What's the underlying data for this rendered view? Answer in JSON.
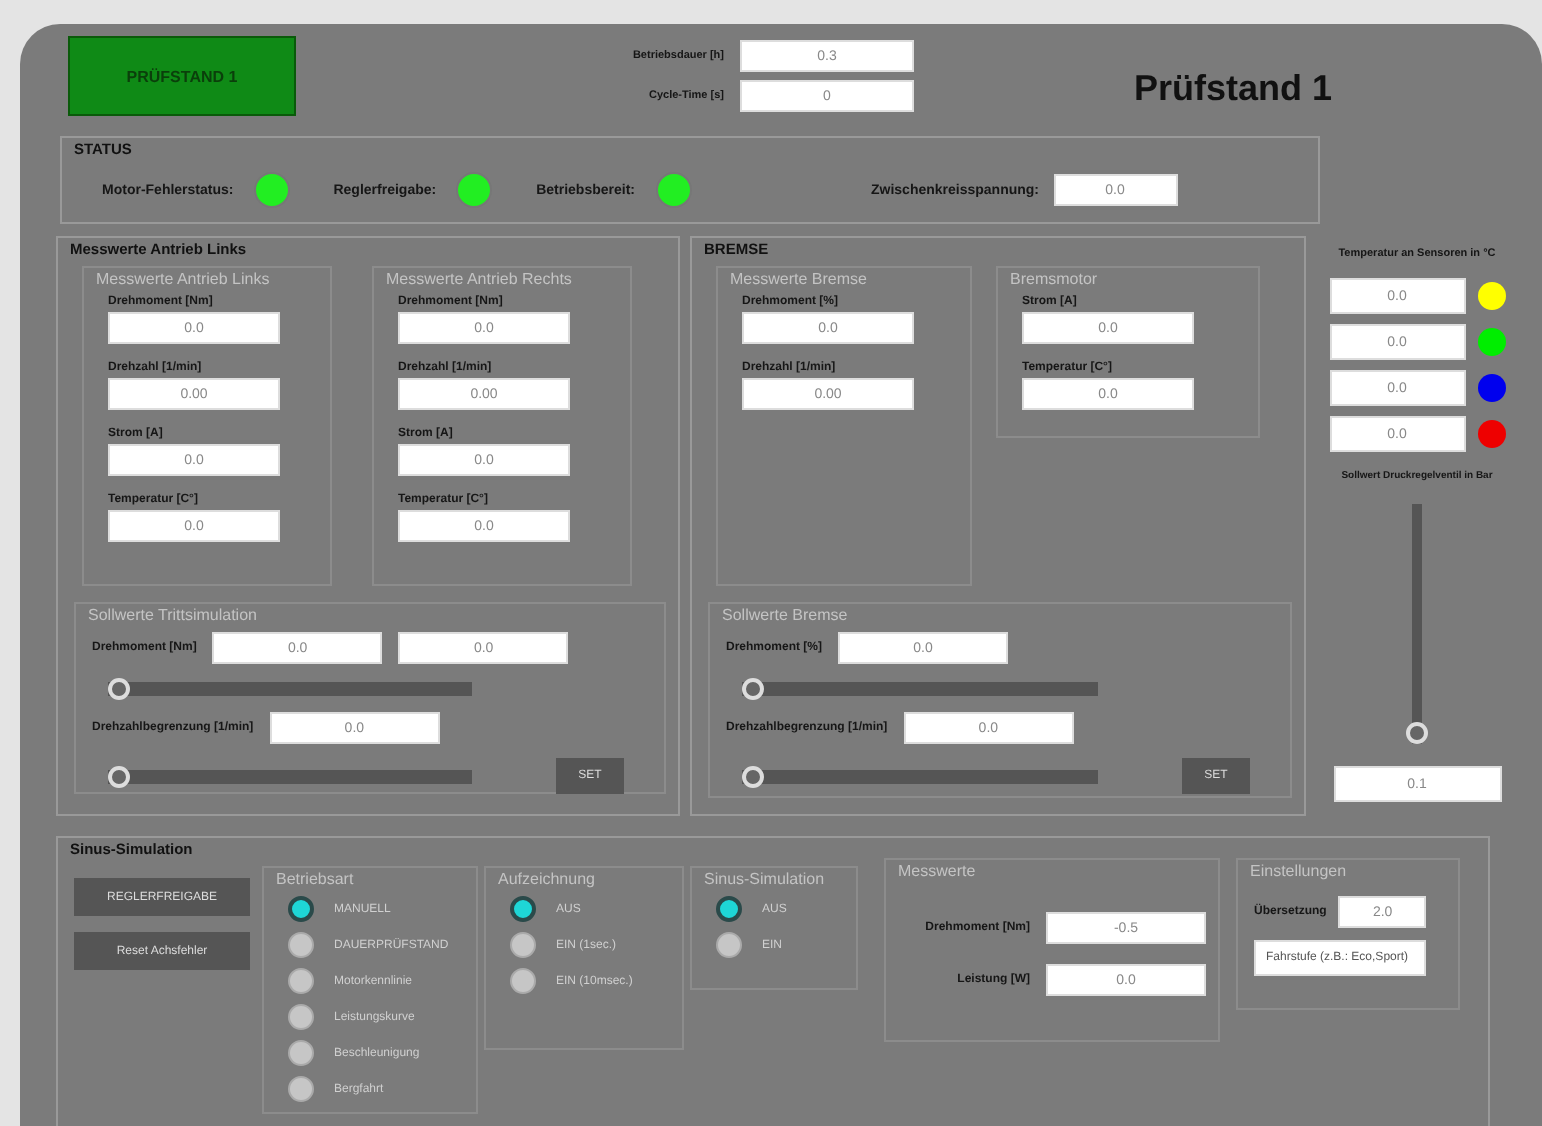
{
  "header": {
    "badge": "PRÜFSTAND 1",
    "title": "Prüfstand 1",
    "fields": [
      {
        "label": "Betriebsdauer [h]",
        "value": "0.3"
      },
      {
        "label": "Cycle-Time [s]",
        "value": "0"
      }
    ]
  },
  "status": {
    "title": "STATUS",
    "indicators": [
      {
        "label": "Motor-Fehlerstatus:",
        "on": true
      },
      {
        "label": "Reglerfreigabe:",
        "on": true
      },
      {
        "label": "Betriebsbereit:",
        "on": true
      }
    ],
    "voltage": {
      "label": "Zwischenkreisspannung:",
      "value": "0.0"
    }
  },
  "antrieb": {
    "title": "Messwerte Antrieb Links",
    "groups": [
      {
        "title": "Messwerte Antrieb Links",
        "fields": [
          {
            "label": "Drehmoment [Nm]",
            "value": "0.0"
          },
          {
            "label": "Drehzahl [1/min]",
            "value": "0.00"
          },
          {
            "label": "Strom [A]",
            "value": "0.0"
          },
          {
            "label": "Temperatur [C°]",
            "value": "0.0"
          }
        ]
      },
      {
        "title": "Messwerte Antrieb Rechts",
        "fields": [
          {
            "label": "Drehmoment [Nm]",
            "value": "0.0"
          },
          {
            "label": "Drehzahl [1/min]",
            "value": "0.00"
          },
          {
            "label": "Strom [A]",
            "value": "0.0"
          },
          {
            "label": "Temperatur [C°]",
            "value": "0.0"
          }
        ]
      }
    ],
    "setpoints": {
      "title": "Sollwerte Trittsimulation",
      "button": "SET",
      "items": [
        {
          "kind": "field",
          "label": "Drehmoment [Nm]",
          "values": [
            "0.0",
            "0.0"
          ]
        },
        {
          "kind": "slider",
          "level": 0
        },
        {
          "kind": "field",
          "label": "Drehzahlbegrenzung [1/min]",
          "values": [
            "0.0"
          ]
        },
        {
          "kind": "slider",
          "level": 0
        }
      ]
    }
  },
  "bremse": {
    "title": "BREMSE",
    "groups": [
      {
        "title": "Messwerte Bremse",
        "fields": [
          {
            "label": "Drehmoment [%]",
            "value": "0.0"
          },
          {
            "label": "Drehzahl [1/min]",
            "value": "0.00"
          }
        ]
      },
      {
        "title": "Bremsmotor",
        "fields": [
          {
            "label": "Strom [A]",
            "value": "0.0"
          },
          {
            "label": "Temperatur [C°]",
            "value": "0.0"
          }
        ]
      }
    ],
    "setpoints": {
      "title": "Sollwerte Bremse",
      "button": "SET",
      "items": [
        {
          "kind": "field",
          "label": "Drehmoment [%]",
          "values": [
            "0.0"
          ]
        },
        {
          "kind": "slider",
          "level": 0
        },
        {
          "kind": "field",
          "label": "Drehzahlbegrenzung [1/min]",
          "values": [
            "0.0"
          ]
        },
        {
          "kind": "slider",
          "level": 0
        }
      ]
    }
  },
  "sensors": {
    "title": "Temperatur an Sensoren in °C",
    "items": [
      {
        "value": "0.0",
        "color": "#ffff00"
      },
      {
        "value": "0.0",
        "color": "#00ee00"
      },
      {
        "value": "0.0",
        "color": "#0000ee"
      },
      {
        "value": "0.0",
        "color": "#ee0000"
      }
    ]
  },
  "pressure": {
    "label": "Sollwert Druckregelventil in Bar",
    "level": 0,
    "value": "0.1"
  },
  "sinus": {
    "title": "Sinus-Simulation",
    "buttons": [
      "REGLERFREIGABE",
      "Reset Achsfehler"
    ],
    "radio_groups": [
      {
        "title": "Betriebsart",
        "options": [
          {
            "label": "MANUELL",
            "selected": true
          },
          {
            "label": "DAUERPRÜFSTAND",
            "selected": false
          },
          {
            "label": "Motorkennlinie",
            "selected": false
          },
          {
            "label": "Leistungskurve",
            "selected": false
          },
          {
            "label": "Beschleunigung",
            "selected": false
          },
          {
            "label": "Bergfahrt",
            "selected": false
          }
        ]
      },
      {
        "title": "Aufzeichnung",
        "options": [
          {
            "label": "AUS",
            "selected": true
          },
          {
            "label": "EIN (1sec.)",
            "selected": false
          },
          {
            "label": "EIN (10msec.)",
            "selected": false
          }
        ]
      },
      {
        "title": "Sinus-Simulation",
        "options": [
          {
            "label": "AUS",
            "selected": true
          },
          {
            "label": "EIN",
            "selected": false
          }
        ]
      }
    ],
    "measurements": {
      "title": "Messwerte",
      "fields": [
        {
          "label": "Drehmoment [Nm]",
          "value": "-0.5"
        },
        {
          "label": "Leistung [W]",
          "value": "0.0"
        }
      ]
    },
    "settings": {
      "title": "Einstellungen",
      "fields": [
        {
          "label": "Übersetzung",
          "value": "2.0"
        }
      ],
      "note": "Fahrstufe (z.B.: Eco,Sport)"
    }
  }
}
